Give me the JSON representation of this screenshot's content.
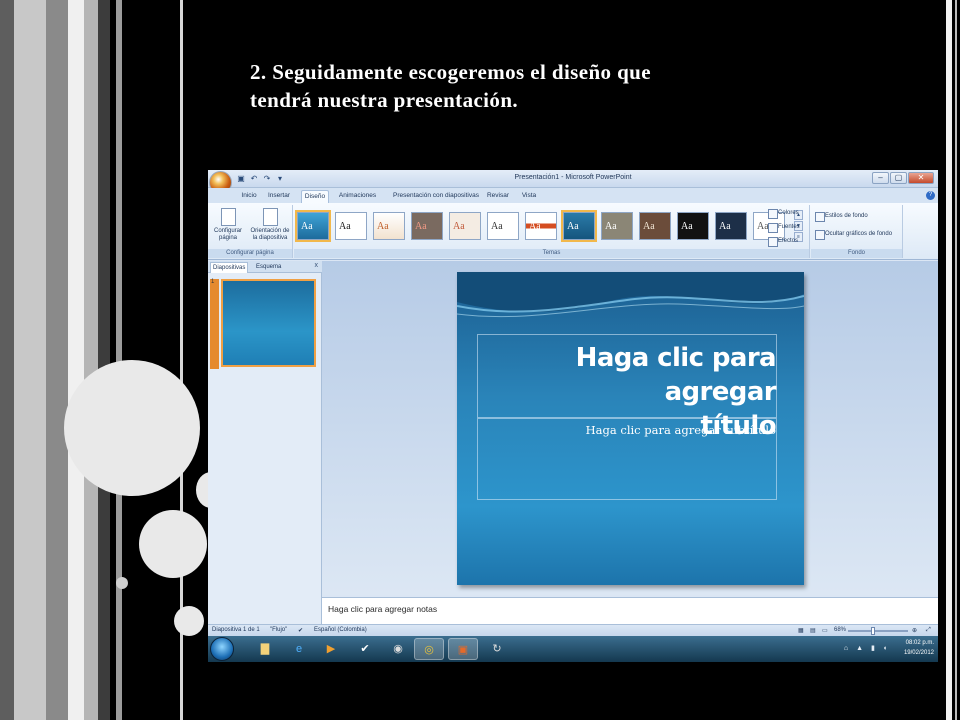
{
  "heading": {
    "line1": "2. Seguidamente escogeremos el diseño que",
    "line2": "tendrá nuestra presentación."
  },
  "window": {
    "title": "Presentación1 - Microsoft PowerPoint",
    "controls": [
      "–",
      "▢",
      "✕"
    ]
  },
  "ribbon": {
    "tabs": [
      "Inicio",
      "Insertar",
      "Diseño",
      "Animaciones",
      "Presentación con diapositivas",
      "Revisar",
      "Vista"
    ],
    "active_tab": "Diseño",
    "config": {
      "btn1": "Configurar página",
      "btn2": "Orientación de la diapositiva",
      "group_label": "Configurar página"
    },
    "themes": {
      "group_label": "Temas",
      "sample": "Aa",
      "count_visible": 13
    },
    "theme_options": {
      "colores": "Colores",
      "fuentes": "Fuentes",
      "efectos": "Efectos"
    },
    "fondo": {
      "estilos": "Estilos de fondo",
      "ocultar": "Ocultar gráficos de fondo",
      "group_label": "Fondo"
    }
  },
  "sidepanel": {
    "tab_slides": "Diapositivas",
    "tab_outline": "Esquema",
    "close": "x",
    "slide_number": "1"
  },
  "slide": {
    "title_line1": "Haga clic para agregar",
    "title_line2": "título",
    "subtitle": "Haga clic para agregar subtítulo"
  },
  "notes": {
    "placeholder": "Haga clic para agregar notas"
  },
  "statusbar": {
    "slide_info": "Diapositiva 1 de 1",
    "theme": "\"Flujo\"",
    "language": "Español (Colombia)",
    "zoom": "68%"
  },
  "taskbar": {
    "time": "08:02 p.m.",
    "date": "19/02/2012"
  }
}
